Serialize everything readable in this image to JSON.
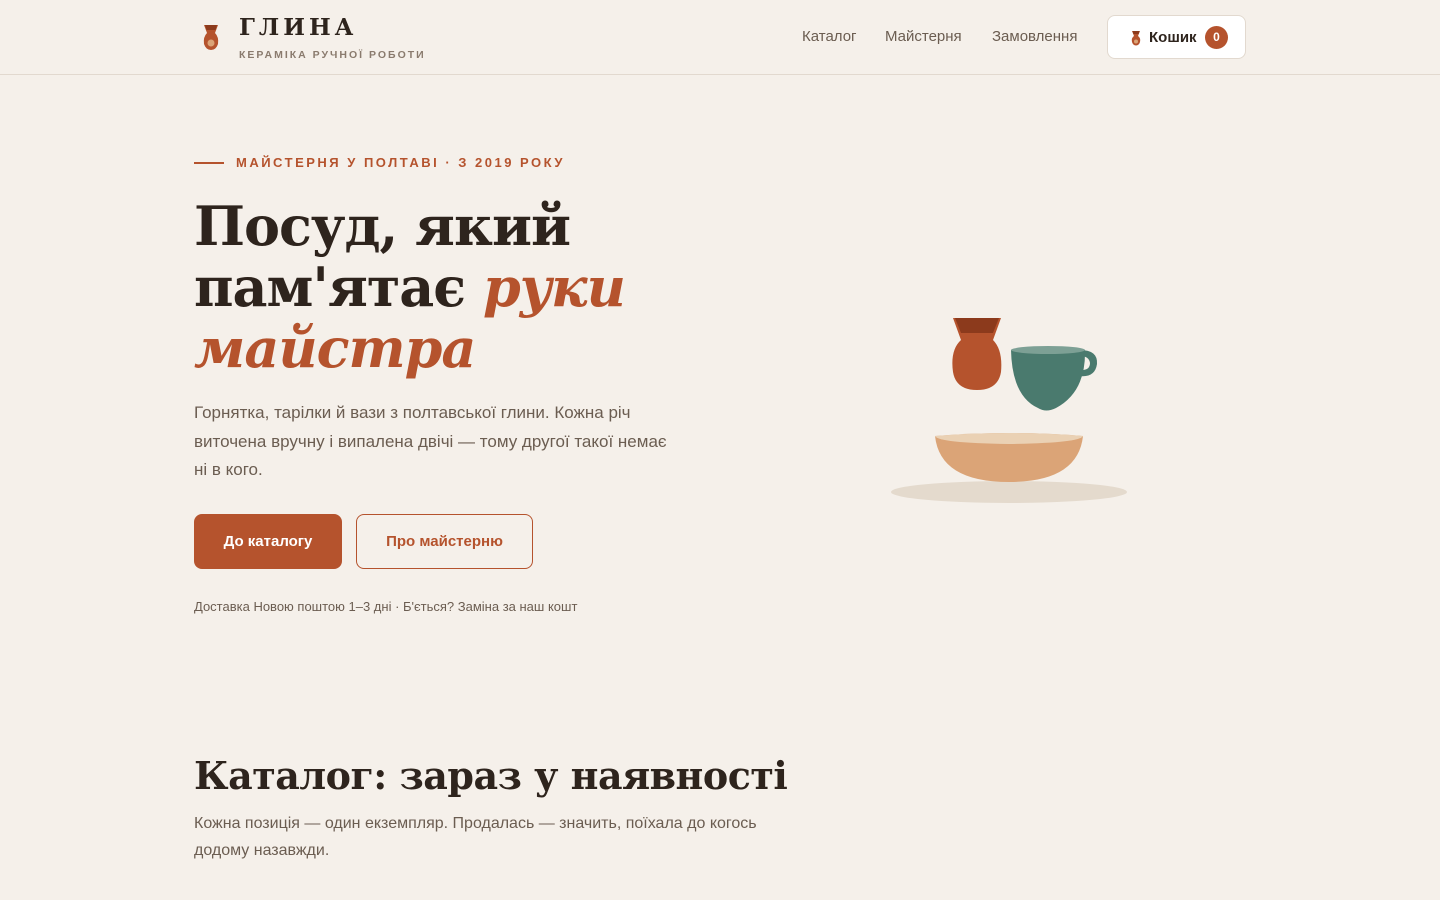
{
  "header": {
    "brand": "ГЛИНА",
    "tagline": "КЕРАМІКА РУЧНОЇ РОБОТИ",
    "nav": [
      {
        "label": "Каталог"
      },
      {
        "label": "Майстерня"
      },
      {
        "label": "Замовлення"
      }
    ],
    "cart": {
      "label": "Кошик",
      "count": "0"
    }
  },
  "hero": {
    "eyebrow": "МАЙСТЕРНЯ У ПОЛТАВІ · З 2019 РОКУ",
    "title_line1": "Посуд, який",
    "title_line2": "пам'ятає",
    "title_accent_1": "руки",
    "title_accent_2": "майстра",
    "text": "Горнятка, тарілки й вази з полтавської глини. Кожна річ виточена вручну і випалена двічі — тому другої такої немає ні в кого.",
    "primary_button": "До каталогу",
    "secondary_button": "Про майстерню",
    "delivery_note": "Доставка Новою поштою 1–3 дні · Б'ється? Заміна за наш кошт"
  },
  "catalog": {
    "title": "Каталог: зараз у наявності",
    "text": "Кожна позиція — один екземпляр. Продалась — значить, поїхала до когось додому назавжди."
  },
  "colors": {
    "accent": "#b5532d",
    "background": "#f5f0ea",
    "teal": "#4a7a6e",
    "sand": "#dba477"
  },
  "icons": {
    "logo": "vase-icon",
    "cart": "vase-icon"
  }
}
